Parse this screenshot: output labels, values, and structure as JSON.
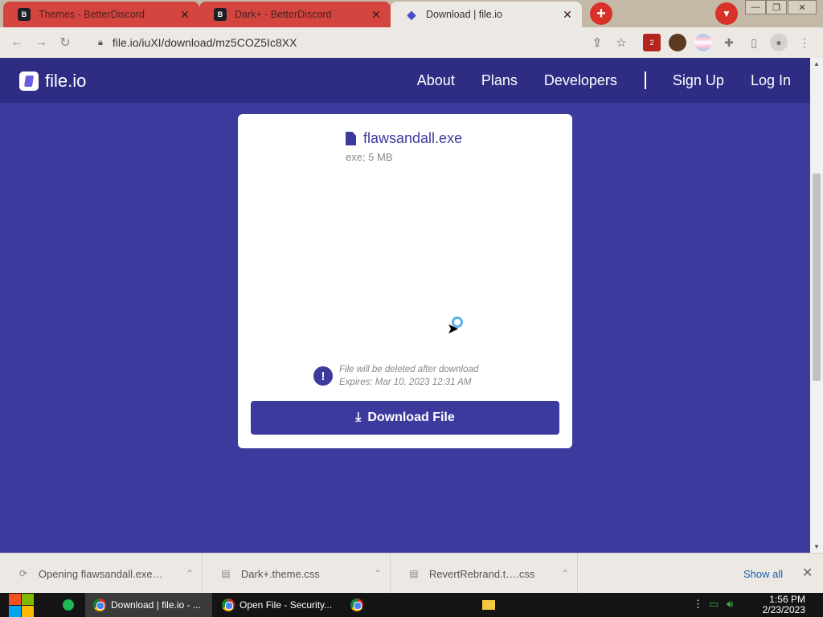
{
  "browser": {
    "tabs": [
      {
        "title": "Themes - BetterDiscord",
        "favicon": "betterdiscord-icon",
        "state": "inactive"
      },
      {
        "title": "Dark+ - BetterDiscord",
        "favicon": "betterdiscord-icon",
        "state": "inactive"
      },
      {
        "title": "Download | file.io",
        "favicon": "fileio-icon",
        "state": "active"
      }
    ],
    "url": "file.io/iuXI/download/mz5COZ5Ic8XX",
    "extension_badge": "2"
  },
  "site": {
    "brand": "file.io",
    "nav": {
      "about": "About",
      "plans": "Plans",
      "developers": "Developers",
      "signup": "Sign Up",
      "login": "Log In"
    }
  },
  "file": {
    "name": "flawsandall.exe",
    "meta": "exe; 5 MB",
    "notice_line1": "File will be deleted after download",
    "notice_line2": "Expires: Mar 10, 2023 12:31 AM",
    "download_label": "Download File"
  },
  "download_shelf": {
    "items": [
      {
        "name": "Opening flawsandall.exe…"
      },
      {
        "name": "Dark+.theme.css"
      },
      {
        "name": "RevertRebrand.t….css"
      }
    ],
    "show_all": "Show all"
  },
  "taskbar": {
    "apps": [
      {
        "title": "Download | file.io - ..."
      },
      {
        "title": "Open File - Security..."
      }
    ],
    "time": "1:56 PM",
    "date": "2/23/2023"
  },
  "colors": {
    "accent": "#3d3a9e",
    "navbar": "#2f2c84",
    "tab_inactive": "#d4453f"
  }
}
